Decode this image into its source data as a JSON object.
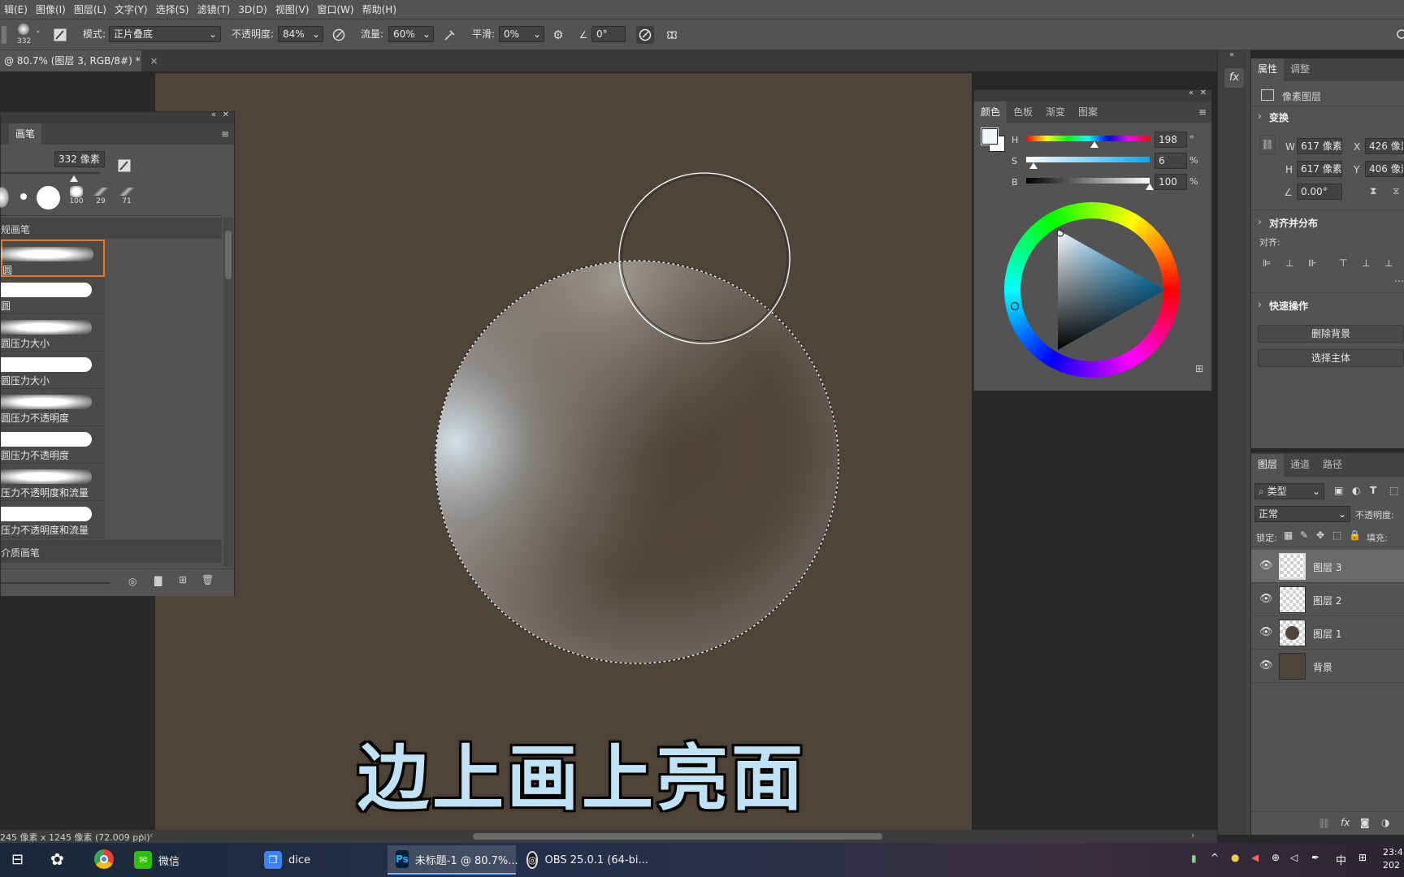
{
  "menu": [
    "辑(E)",
    "图像(I)",
    "图层(L)",
    "文字(Y)",
    "选择(S)",
    "滤镜(T)",
    "3D(D)",
    "视图(V)",
    "窗口(W)",
    "帮助(H)"
  ],
  "options": {
    "brush_size": "332",
    "mode_label": "模式:",
    "mode_value": "正片叠底",
    "opacity_label": "不透明度:",
    "opacity_value": "84%",
    "flow_label": "流量:",
    "flow_value": "60%",
    "smooth_label": "平滑:",
    "smooth_value": "0%",
    "angle_value": "0°"
  },
  "doc_tab": {
    "title": "@ 80.7% (图层 3, RGB/8#) *",
    "close": "×"
  },
  "brush_panel": {
    "tab": "画笔",
    "size_value": "332 像素",
    "preset_nums": [
      "100",
      "29",
      "71"
    ],
    "group_general": "规画笔",
    "brushes": [
      "圆",
      "圆",
      "圆压力大小",
      "圆压力大小",
      "圆压力不透明度",
      "圆压力不透明度",
      "压力不透明度和流量",
      "压力不透明度和流量"
    ],
    "group_media": "介质画笔"
  },
  "color_panel": {
    "tabs": [
      "颜色",
      "色板",
      "渐变",
      "图案"
    ],
    "h_label": "H",
    "h_value": "198",
    "h_unit": "°",
    "s_label": "S",
    "s_value": "6",
    "s_unit": "%",
    "b_label": "B",
    "b_value": "100",
    "b_unit": "%",
    "h_level": 0.55,
    "s_level": 0.06,
    "b_level": 1.0,
    "foreground": "#f0f6f9"
  },
  "properties": {
    "tabs": [
      "属性",
      "调整"
    ],
    "kind": "像素图层",
    "transform_title": "变换",
    "w_label": "W",
    "w_value": "617 像素",
    "x_label": "X",
    "x_value": "426 像素",
    "h_label": "H",
    "h_value": "617 像素",
    "y_label": "Y",
    "y_value": "406 像素",
    "angle_value": "0.00°",
    "align_title": "对齐并分布",
    "align_label": "对齐:",
    "quick_title": "快速操作",
    "btn_remove_bg": "删除背景",
    "btn_select_subject": "选择主体"
  },
  "layers_panel": {
    "tabs": [
      "图层",
      "通道",
      "路径"
    ],
    "filter_value": "类型",
    "blend_value": "正常",
    "opacity_label": "不透明度:",
    "lock_label": "锁定:",
    "fill_label": "填充:",
    "layers": [
      {
        "name": "图层 3",
        "selected": true
      },
      {
        "name": "图层 2",
        "selected": false
      },
      {
        "name": "图层 1",
        "selected": false
      },
      {
        "name": "背景",
        "selected": false
      }
    ]
  },
  "status": "245 像素 x 1245 像素 (72.009 ppi)",
  "subtitle": "边上画上亮面",
  "taskbar": {
    "apps": [
      {
        "label": "微信"
      },
      {
        "label": "dice"
      },
      {
        "label": "未标题-1 @ 80.7%..."
      },
      {
        "label": "OBS 25.0.1 (64-bi..."
      }
    ],
    "ime": "中",
    "clock_time": "23:4",
    "clock_date": "202"
  },
  "colors": {
    "canvas_bg": "#4f4438",
    "panel": "#535353",
    "subtitle_fill": "#bfe2f4",
    "selection_orange": "#e07a2a"
  }
}
